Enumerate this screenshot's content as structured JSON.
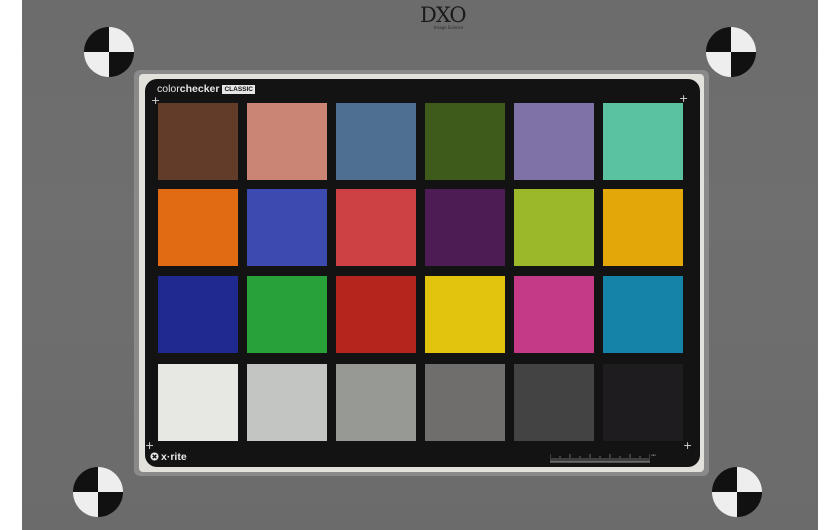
{
  "header": {
    "logo_text": "DXO",
    "logo_subtext": "Image Science"
  },
  "chart": {
    "brand_light": "color",
    "brand_bold": "checker",
    "brand_tag": "CLASSIC",
    "footer_logo": "x·rite",
    "ruler_unit": "mm"
  },
  "colors": {
    "background": "#6d6d6d",
    "card": "#131313",
    "rows": [
      [
        "#623b29",
        "#ca8575",
        "#4f6f92",
        "#3f5b1c",
        "#7e72a6",
        "#5ac2a1"
      ],
      [
        "#e06b13",
        "#3d4bb0",
        "#cd4043",
        "#4d1c54",
        "#9bb72a",
        "#e3a70a"
      ],
      [
        "#1f2990",
        "#28a238",
        "#b6251d",
        "#e2c30e",
        "#c43a87",
        "#1583a7"
      ],
      [
        "#e7e7e3",
        "#c3c5c2",
        "#979995",
        "#6f6e6c",
        "#434343",
        "#1e1c1f"
      ]
    ]
  },
  "icons": [
    "registration-target-icon",
    "xrite-logo-icon",
    "crosshair-icon"
  ]
}
